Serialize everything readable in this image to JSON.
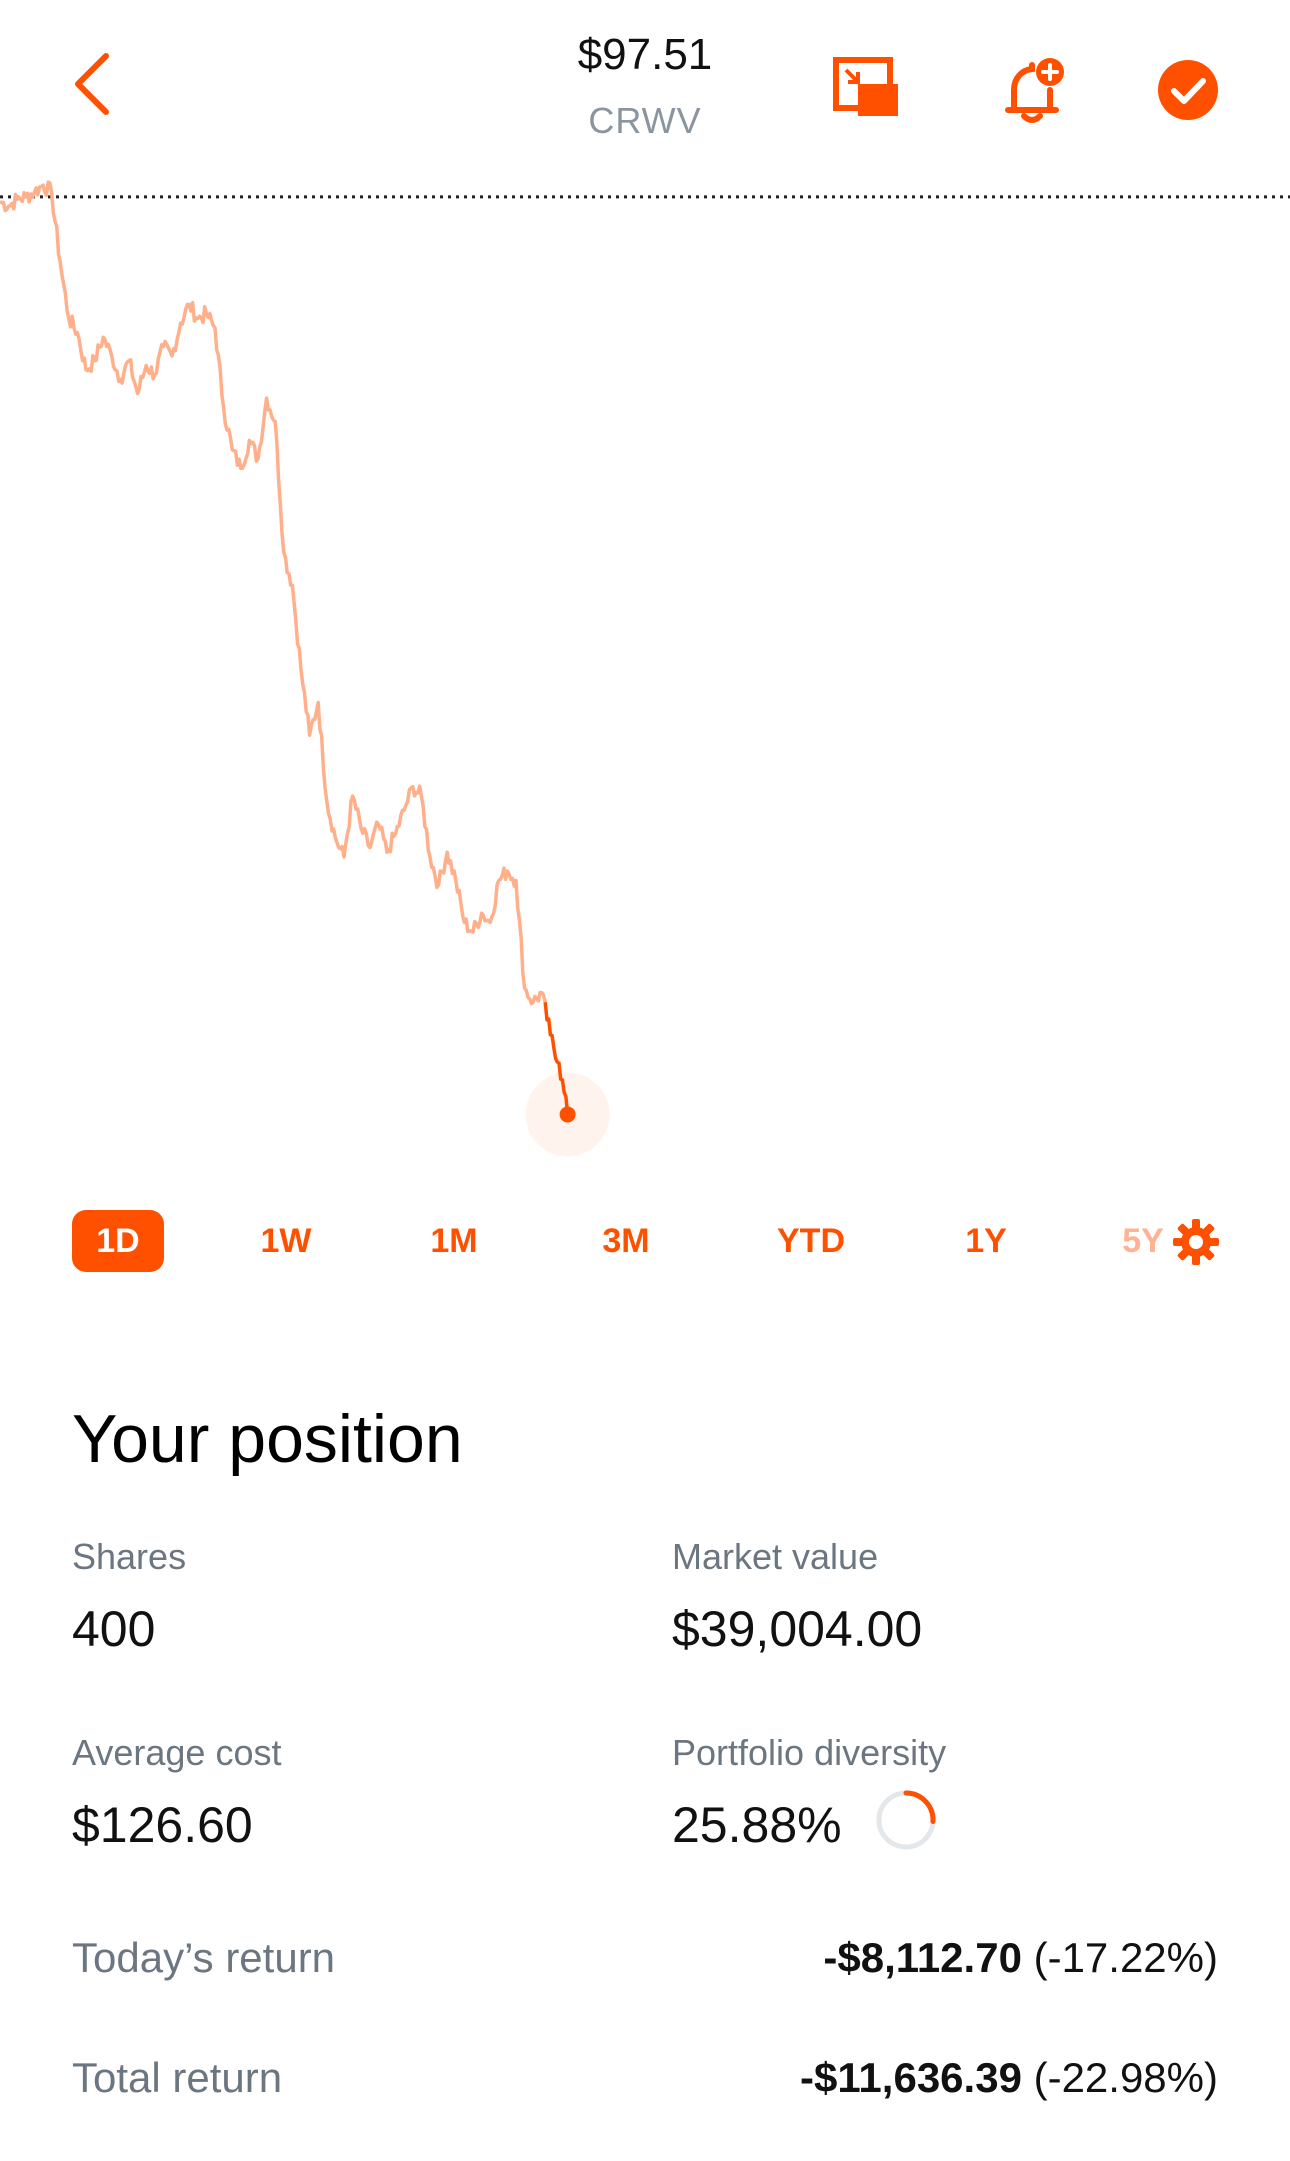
{
  "header": {
    "price": "$97.51",
    "ticker": "CRWV",
    "icons": [
      "chevron-left-icon",
      "picture-in-picture-icon",
      "bell-add-icon",
      "checkmark-circle-icon"
    ]
  },
  "colors": {
    "accent": "#ff5000",
    "line_light": "#ffb08a",
    "text_muted": "#6b7680"
  },
  "chart_data": {
    "type": "line",
    "series": [
      {
        "values": [
          106.4,
          106.3,
          106.45,
          106.5,
          106.6,
          106.75,
          106.6,
          105.1,
          103.9,
          103.6,
          102.8,
          103.0,
          103.5,
          103.1,
          102.6,
          103.0,
          102.3,
          102.9,
          102.7,
          103.3,
          103.1,
          103.8,
          104.2,
          103.9,
          104.0,
          103.7,
          102.0,
          101.1,
          100.7,
          101.3,
          100.9,
          102.2,
          101.7,
          98.9,
          98.2,
          96.4,
          95.0,
          95.7,
          93.6,
          92.8,
          92.4,
          93.7,
          93.0,
          92.6,
          93.1,
          92.5,
          92.9,
          93.4,
          93.9,
          93.7,
          92.4,
          91.8,
          92.5,
          91.9,
          91.0,
          90.8,
          91.2,
          91.0,
          91.9,
          92.1,
          91.9,
          89.6,
          89.3,
          89.5,
          88.6,
          88.0,
          86.9
        ]
      }
    ],
    "reference_line": 106.5,
    "x_range": [
      0,
      150
    ],
    "y_range": [
      85.5,
      107.5
    ],
    "last_point_highlight": true
  },
  "ranges": [
    "1D",
    "1W",
    "1M",
    "3M",
    "YTD",
    "1Y",
    "5Y"
  ],
  "active_range": "1D",
  "position": {
    "title": "Your position",
    "shares_label": "Shares",
    "shares_value": "400",
    "market_value_label": "Market value",
    "market_value": "$39,004.00",
    "avg_cost_label": "Average cost",
    "avg_cost_value": "$126.60",
    "diversity_label": "Portfolio diversity",
    "diversity_value": "25.88%",
    "diversity_fraction": 0.2588,
    "todays_return_label": "Today’s return",
    "todays_return_amount": "-$8,112.70",
    "todays_return_pct": "(-17.22%)",
    "total_return_label": "Total return",
    "total_return_amount": "-$11,636.39",
    "total_return_pct": "(-22.98%)"
  }
}
